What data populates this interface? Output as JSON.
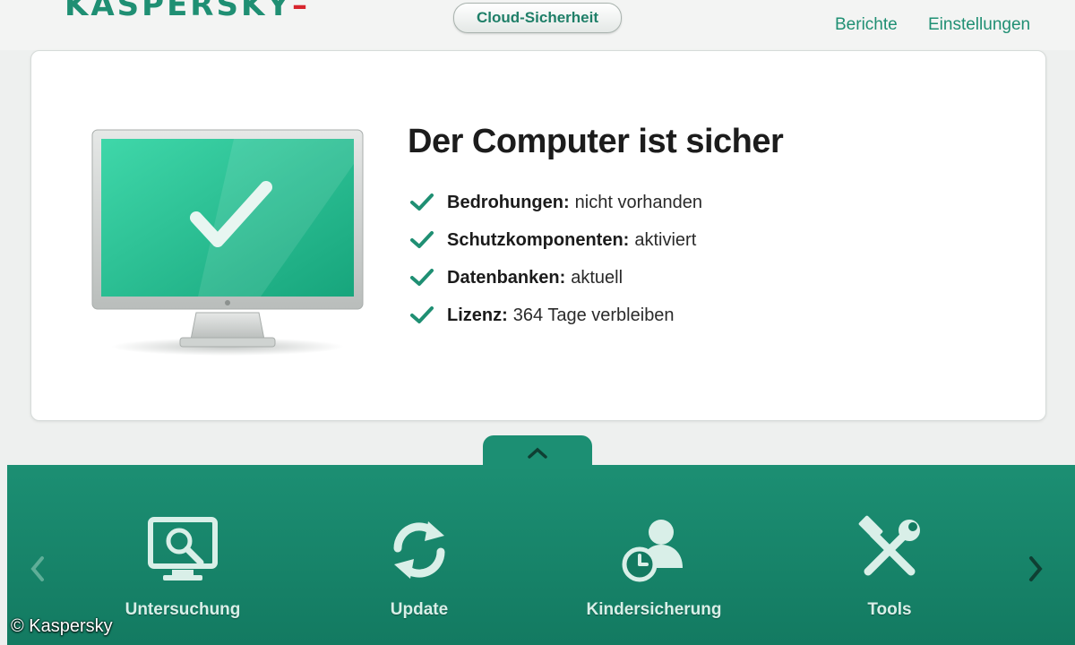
{
  "header": {
    "logo_text": "KASPERSKY",
    "logo_suffix": "–",
    "cloud_button": "Cloud-Sicherheit",
    "links": {
      "reports": "Berichte",
      "settings": "Einstellungen"
    }
  },
  "status": {
    "title": "Der Computer ist sicher",
    "items": [
      {
        "label": "Bedrohungen:",
        "value": "nicht vorhanden"
      },
      {
        "label": "Schutzkomponenten:",
        "value": "aktiviert"
      },
      {
        "label": "Datenbanken:",
        "value": "aktuell"
      },
      {
        "label": "Lizenz:",
        "value": "364 Tage verbleiben"
      }
    ]
  },
  "tools": [
    {
      "label": "Untersuchung",
      "icon": "scan-monitor-icon"
    },
    {
      "label": "Update",
      "icon": "refresh-icon"
    },
    {
      "label": "Kindersicherung",
      "icon": "parental-control-icon"
    },
    {
      "label": "Tools",
      "icon": "tools-icon"
    }
  ],
  "copyright": "© Kaspersky",
  "colors": {
    "accent": "#1c8f73",
    "screen": "#2ec89b",
    "check": "#1f8f73"
  }
}
